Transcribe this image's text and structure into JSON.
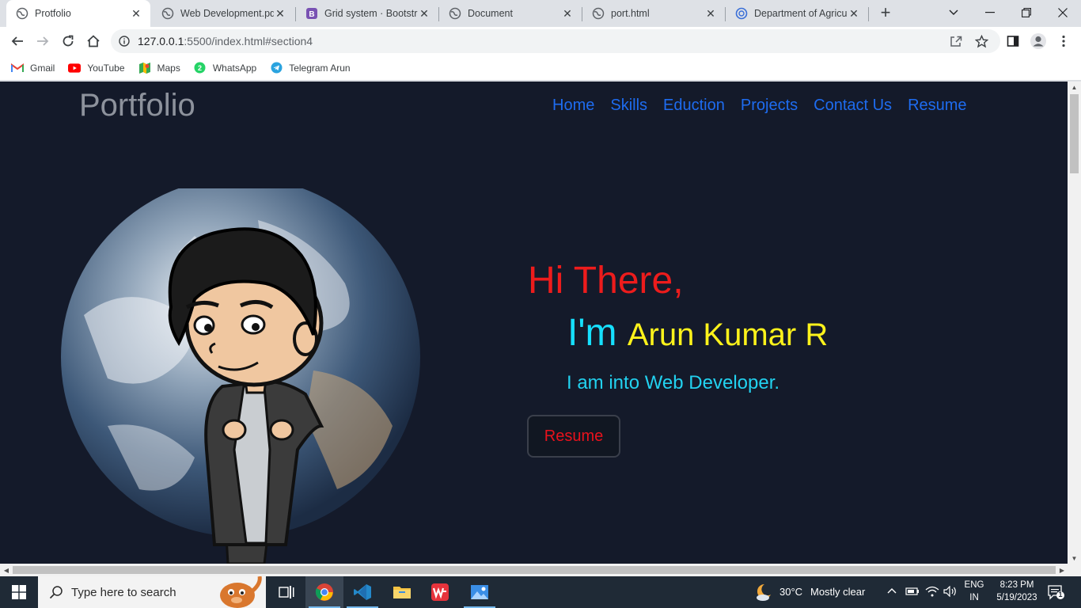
{
  "browser": {
    "tabs": [
      {
        "title": "Protfolio",
        "active": true,
        "icon": "globe-icon"
      },
      {
        "title": "Web Development.pdf",
        "active": false,
        "icon": "globe-icon"
      },
      {
        "title": "Grid system · Bootstrap",
        "active": false,
        "icon": "bootstrap-icon"
      },
      {
        "title": "Document",
        "active": false,
        "icon": "globe-icon"
      },
      {
        "title": "port.html",
        "active": false,
        "icon": "globe-icon"
      },
      {
        "title": "Department of Agriculture",
        "active": false,
        "icon": "agri-icon"
      }
    ],
    "url_host": "127.0.0.1",
    "url_path": ":5500/index.html#section4",
    "bookmarks": [
      {
        "label": "Gmail",
        "icon": "gmail-icon"
      },
      {
        "label": "YouTube",
        "icon": "youtube-icon"
      },
      {
        "label": "Maps",
        "icon": "maps-icon"
      },
      {
        "label": "WhatsApp",
        "icon": "whatsapp-icon"
      },
      {
        "label": "Telegram Arun",
        "icon": "telegram-icon"
      }
    ]
  },
  "page": {
    "brand": "Portfolio",
    "nav": [
      "Home",
      "Skills",
      "Eduction",
      "Projects",
      "Contact Us",
      "Resume"
    ],
    "greeting": "Hi There,",
    "iam_prefix": "I'm",
    "name": "Arun Kumar R",
    "role": "I am into Web Developer.",
    "resume_button": "Resume",
    "colors": {
      "background": "#141a2a",
      "nav_link": "#1e6cf0",
      "greeting": "#ed1c1c",
      "iam": "#16e0ff",
      "name": "#fdf21b"
    }
  },
  "taskbar": {
    "search_placeholder": "Type here to search",
    "weather_temp": "30°C",
    "weather_text": "Mostly clear",
    "lang": "ENG",
    "region": "IN",
    "time": "8:23 PM",
    "date": "5/19/2023",
    "notification_count": "1"
  }
}
